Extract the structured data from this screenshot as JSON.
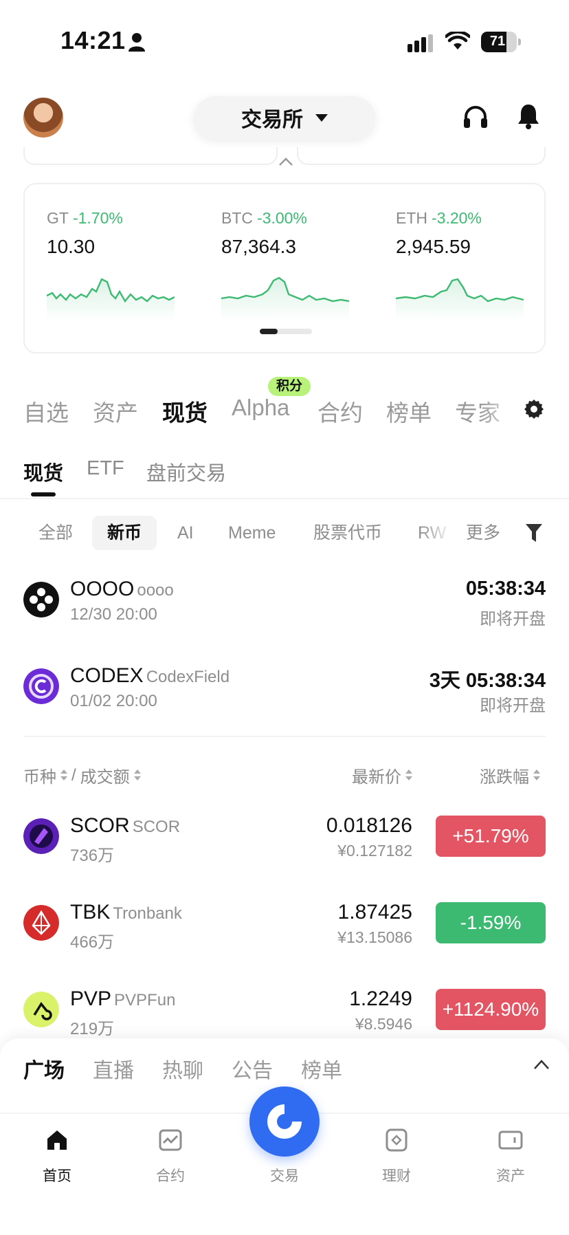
{
  "status_bar": {
    "time": "14:21",
    "battery": "71",
    "battery_level": 0.71
  },
  "header": {
    "exchange_label": "交易所"
  },
  "tickers": [
    {
      "symbol": "GT",
      "change": "-1.70%",
      "price": "10.30"
    },
    {
      "symbol": "BTC",
      "change": "-3.00%",
      "price": "87,364.3"
    },
    {
      "symbol": "ETH",
      "change": "-3.20%",
      "price": "2,945.59"
    }
  ],
  "main_tabs": [
    {
      "label": "自选"
    },
    {
      "label": "资产"
    },
    {
      "label": "现货"
    },
    {
      "label": "Alpha"
    },
    {
      "label": "合约"
    },
    {
      "label": "榜单"
    },
    {
      "label": "专家"
    }
  ],
  "alpha_badge": "积分",
  "sub_tabs": [
    {
      "label": "现货"
    },
    {
      "label": "ETF"
    },
    {
      "label": "盘前交易"
    }
  ],
  "chips": [
    {
      "label": "全部"
    },
    {
      "label": "新币"
    },
    {
      "label": "AI"
    },
    {
      "label": "Meme"
    },
    {
      "label": "股票代币"
    },
    {
      "label": "RW"
    },
    {
      "label": "更多"
    }
  ],
  "new_listings": [
    {
      "symbol": "OOOO",
      "name": "oooo",
      "date": "12/30 20:00",
      "countdown": "05:38:34",
      "status": "即将开盘"
    },
    {
      "symbol": "CODEX",
      "name": "CodexField",
      "date": "01/02 20:00",
      "countdown": "3天 05:38:34",
      "status": "即将开盘"
    }
  ],
  "list_header": {
    "coin_col": "币种",
    "volume_col": "成交额",
    "price_col": "最新价",
    "change_col": "涨跌幅"
  },
  "coins": [
    {
      "symbol": "SCOR",
      "name": "SCOR",
      "volume": "736万",
      "price": "0.018126",
      "cny": "¥0.127182",
      "change": "+51.79%"
    },
    {
      "symbol": "TBK",
      "name": "Tronbank",
      "volume": "466万",
      "price": "1.87425",
      "cny": "¥13.15086",
      "change": "-1.59%"
    },
    {
      "symbol": "PVP",
      "name": "PVPFun",
      "volume": "219万",
      "price": "1.2249",
      "cny": "¥8.5946",
      "change": "+1124.90%"
    }
  ],
  "feed_tabs": [
    {
      "label": "广场"
    },
    {
      "label": "直播"
    },
    {
      "label": "热聊"
    },
    {
      "label": "公告"
    },
    {
      "label": "榜单"
    }
  ],
  "bottom_nav": [
    {
      "label": "首页",
      "icon": "home-icon"
    },
    {
      "label": "合约",
      "icon": "futures-icon"
    },
    {
      "label": "交易",
      "icon": "trade-icon"
    },
    {
      "label": "理财",
      "icon": "earn-icon"
    },
    {
      "label": "资产",
      "icon": "wallet-icon"
    }
  ],
  "colors": {
    "up": "#e45563",
    "down": "#3dba72",
    "accent": "#2f6cf2",
    "badge": "#b8f27a"
  }
}
